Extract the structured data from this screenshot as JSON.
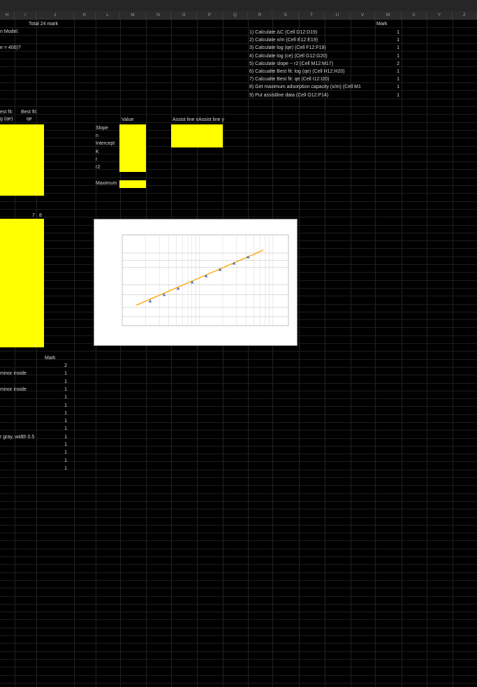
{
  "columns": [
    "H",
    "I",
    "J",
    "K",
    "L",
    "M",
    "N",
    "O",
    "P",
    "Q",
    "R",
    "S",
    "T",
    "U",
    "V",
    "W",
    "X",
    "Y",
    "Z"
  ],
  "sheet": {
    "total_mark": "Total 24 mark",
    "model_text": "n Model.",
    "question_text": "e = 400)?",
    "best_fit_log_header_1": "est fit:",
    "best_fit_log_header_2": "g (qe)",
    "best_fit_qe_header_1": "Best fit:",
    "best_fit_qe_header_2": "qe",
    "value_header": "Value",
    "assist_line_x": "Assist line x",
    "assist_line_y": "Assist line y",
    "params": [
      "Slope",
      "n",
      "Intercept",
      "K",
      "r",
      "r2"
    ],
    "maximum_label": "Maximum",
    "num_7": "7",
    "num_8": "8",
    "mark_header": "Mark",
    "left_notes": [
      {
        "row": 1,
        "text": "minor inside"
      },
      {
        "row": 3,
        "text": "minor inside"
      },
      {
        "row": 9,
        "text": "r gray, width 0.5"
      }
    ],
    "marks_lower": [
      "2",
      "1",
      "1",
      "1",
      "1",
      "1",
      "1",
      "1",
      "1",
      "1",
      "1",
      "1",
      "1",
      "1"
    ],
    "tasks": [
      "1) Calculate ΔC (Cell D12:D19)",
      "2) Calculate x/m (Cell E12:E19)",
      "3) Calculate log (qe) (Cell F12:F19)",
      "4) Calculate log (ce) (Cell G12:G20)",
      "5) Calculate slope ~ r2 (Cell M12:M17)",
      "6) Calcualte Best fit: log (qe) (Cell H12:H20)",
      "7) Calcualte Best fit: qe (Cell I12:I20)",
      "8) Get maximum adsorption capacity (x/m) (Cell M1",
      "9) Put assistline data (Cell O12:P14)"
    ],
    "mark_header_right": "Mark",
    "marks_right": [
      "1",
      "1",
      "1",
      "1",
      "2",
      "1",
      "1",
      "1",
      "1"
    ]
  },
  "chart_data": {
    "type": "scatter",
    "title": "",
    "xlabel": "",
    "ylabel": "",
    "x_scale": "log",
    "marker_color": "#4472c4",
    "line_color": "#ffa500",
    "points": [
      [
        1,
        1
      ],
      [
        2,
        2
      ],
      [
        3,
        3
      ],
      [
        4,
        4
      ],
      [
        5,
        5
      ],
      [
        6,
        6
      ],
      [
        7,
        7
      ],
      [
        8,
        8
      ]
    ],
    "fit_line": [
      [
        0,
        0.4
      ],
      [
        10,
        10
      ]
    ]
  }
}
